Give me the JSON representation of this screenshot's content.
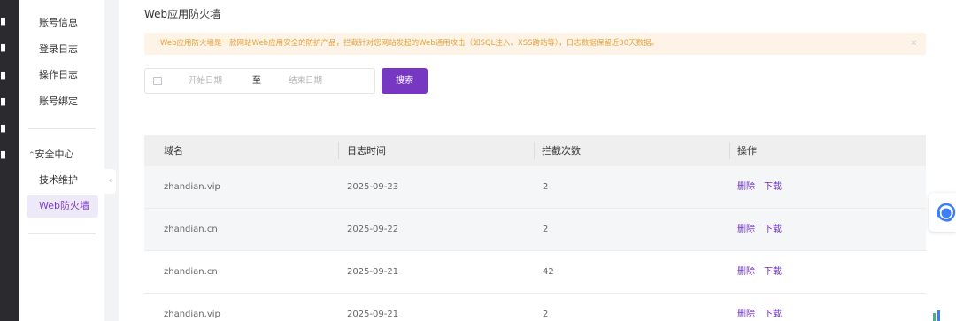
{
  "colors": {
    "accent": "#7637c2",
    "rail": "#2b2b2f",
    "alert_bg": "#fdf3e6",
    "alert_text": "#e6a23c"
  },
  "sub_sidebar": {
    "account_items": [
      "账号信息",
      "登录日志",
      "操作日志",
      "账号绑定"
    ],
    "security_group": "安全中心",
    "security_items": [
      "技术维护"
    ],
    "active_item": "Web防火墙"
  },
  "page": {
    "title": "Web应用防火墙",
    "alert": "Web应用防火墙是一款网站Web应用安全的防护产品，拦截针对您网站发起的Web通用攻击（如SQL注入、XSS跨站等），日志数据保留近30天数据。",
    "alert_close": "×"
  },
  "filter": {
    "start_placeholder": "开始日期",
    "separator": "至",
    "end_placeholder": "结束日期",
    "search_label": "搜索"
  },
  "table": {
    "headers": [
      "域名",
      "日志时间",
      "拦截次数",
      "操作"
    ],
    "rows": [
      {
        "domain": "zhandian.vip",
        "date": "2025-09-23",
        "count": "2",
        "delete": "删除",
        "download": "下载"
      },
      {
        "domain": "zhandian.cn",
        "date": "2025-09-22",
        "count": "2",
        "delete": "删除",
        "download": "下载"
      },
      {
        "domain": "zhandian.cn",
        "date": "2025-09-21",
        "count": "42",
        "delete": "删除",
        "download": "下载"
      },
      {
        "domain": "zhandian.vip",
        "date": "2025-09-21",
        "count": "2",
        "delete": "删除",
        "download": "下载"
      }
    ]
  },
  "icons": {
    "calendar": "calendar-icon",
    "support": "headset-icon",
    "collapse": "chevron-left-icon",
    "expand": "chevron-down-icon",
    "close": "close-icon"
  }
}
